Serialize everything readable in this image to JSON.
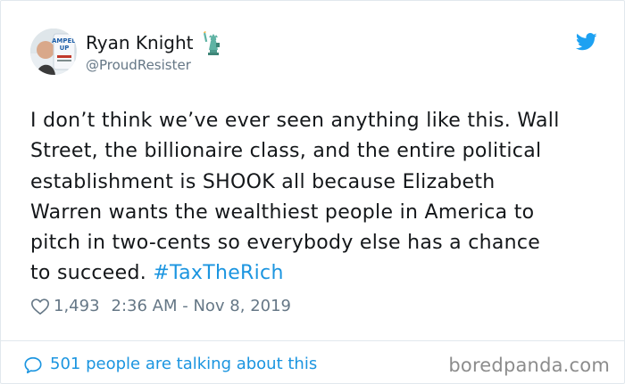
{
  "user": {
    "display_name": "Ryan Knight",
    "handle": "@ProudResister",
    "avatar_sign_text": "AMPED UP",
    "name_emoji": "statue-of-liberty-emoji"
  },
  "tweet": {
    "lines": [
      "I don’t think we’ve ever seen anything like this. Wall",
      "Street, the billionaire class, and the entire political",
      "establishment is SHOOK all because Elizabeth",
      "Warren wants the wealthiest people in America to",
      "pitch in two-cents so everybody else has a chance",
      "to succeed. "
    ],
    "hashtag": "#TaxTheRich",
    "likes": "1,493",
    "timestamp": "2:36 AM - Nov 8, 2019"
  },
  "footer": {
    "talking_text": "501 people are talking about this",
    "watermark": "boredpanda.com"
  },
  "icons": {
    "twitter": "twitter-bird-icon",
    "like": "heart-icon",
    "talking": "speech-bubble-icon"
  },
  "colors": {
    "twitter_blue": "#1da1f2",
    "link_blue": "#1b95e0",
    "secondary_gray": "#657786",
    "border": "#e1e8ed"
  }
}
